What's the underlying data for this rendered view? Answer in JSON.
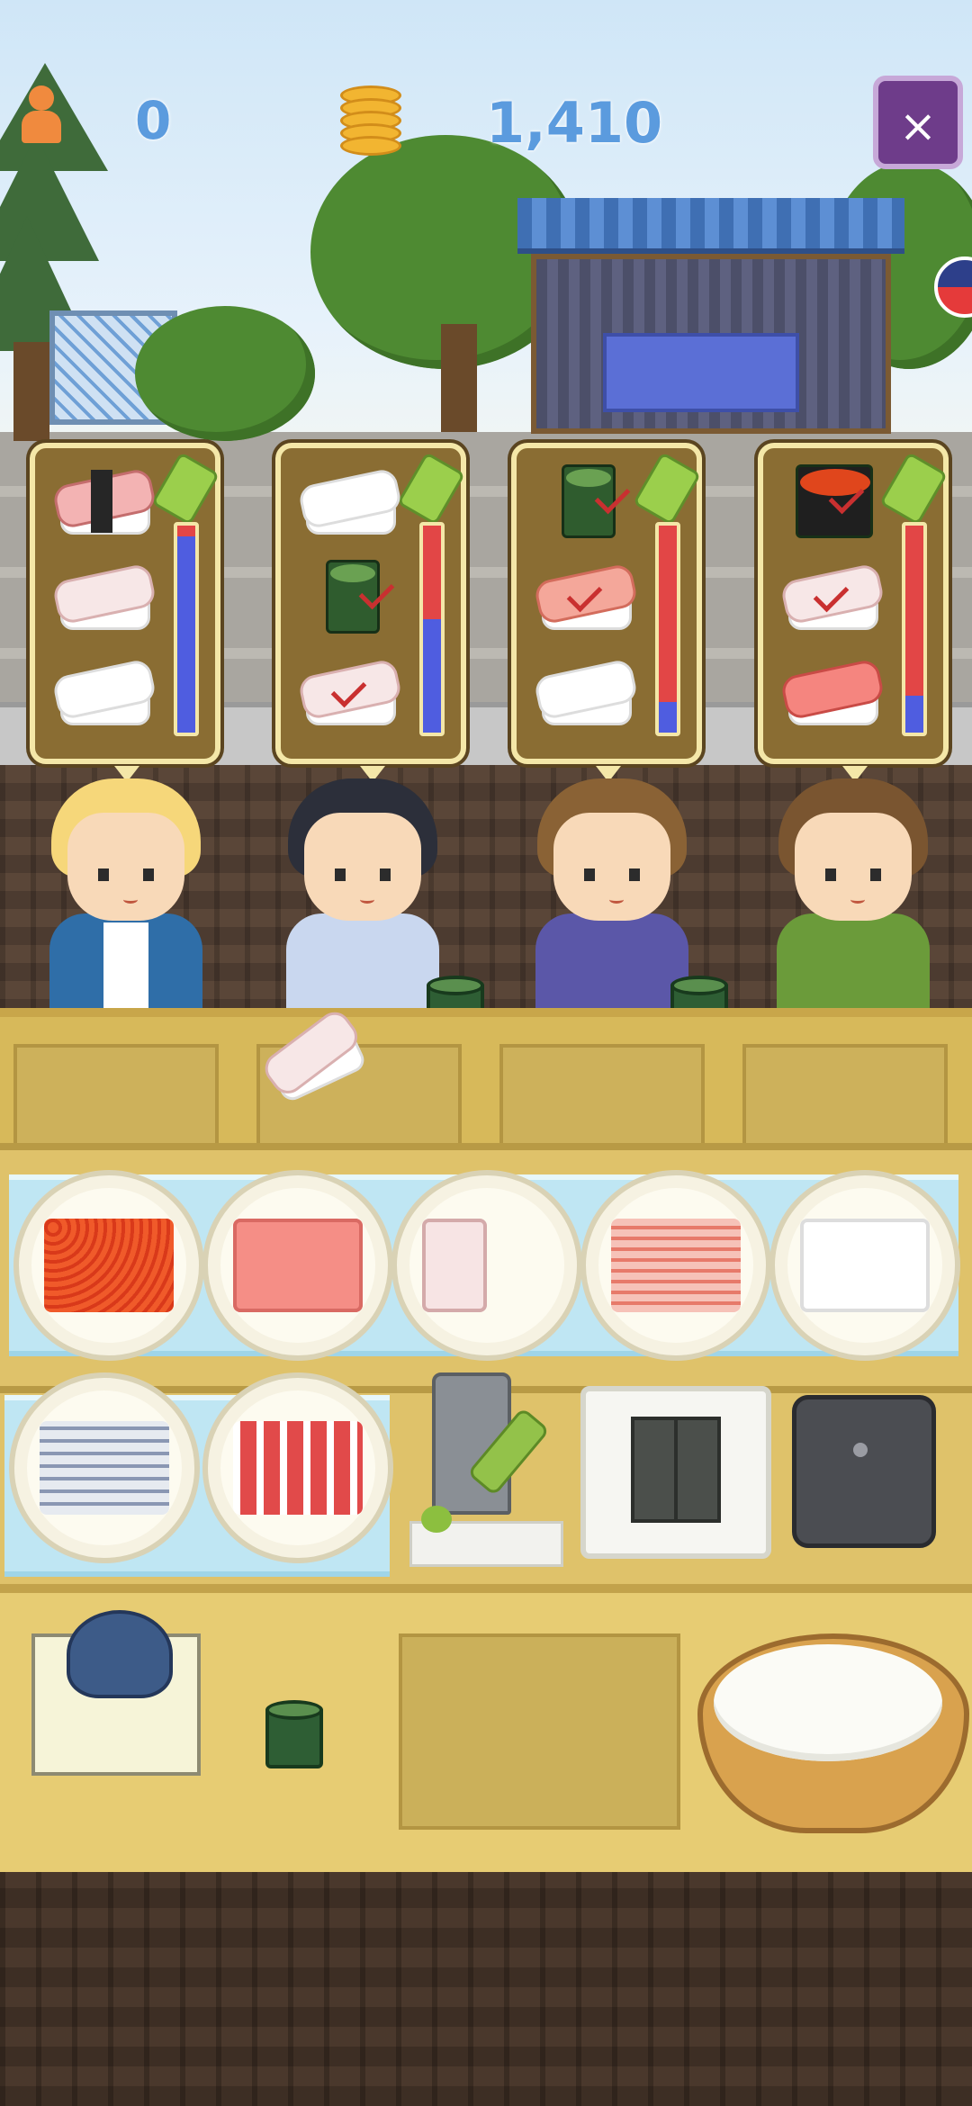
{
  "hud": {
    "customers_count": "0",
    "coins": "1,410",
    "close_label": "×"
  },
  "icons": {
    "customer_icon": "person-icon",
    "coin_icon": "coin-stack-icon",
    "close_icon": "close-icon",
    "wasabi_icon": "wasabi-icon",
    "check_icon": "check-icon"
  },
  "orders": [
    {
      "items": [
        "nigiri-tuna-ribbon",
        "nigiri-fish",
        "nigiri-squid"
      ],
      "patience": 0.95
    },
    {
      "items": [
        "nigiri-squid",
        "gunkan-seaweed",
        "nigiri-fish-checked"
      ],
      "patience": 0.55
    },
    {
      "items": [
        "gunkan-checked",
        "nigiri-shrimp-checked",
        "nigiri-squid"
      ],
      "patience": 0.15
    },
    {
      "items": [
        "gunkan-salmon-roe-checked",
        "nigiri-fish-checked",
        "nigiri-tuna"
      ],
      "patience": 0.18
    }
  ],
  "colors": {
    "meter_remaining": "#4f5de0",
    "meter_empty": "#e24646",
    "panel_bg": "#8a6d33",
    "panel_border": "#f4e7a8"
  },
  "ingredients_row1": [
    "salmon-roe",
    "tuna",
    "sea-bream",
    "shrimp",
    "squid"
  ],
  "ingredients_row2": [
    "mackerel",
    "red-clam"
  ],
  "tools": [
    "wasabi-grater",
    "nori-fridge",
    "rice-cooker",
    "soy-sauce",
    "cutting-board",
    "rice-tub"
  ]
}
